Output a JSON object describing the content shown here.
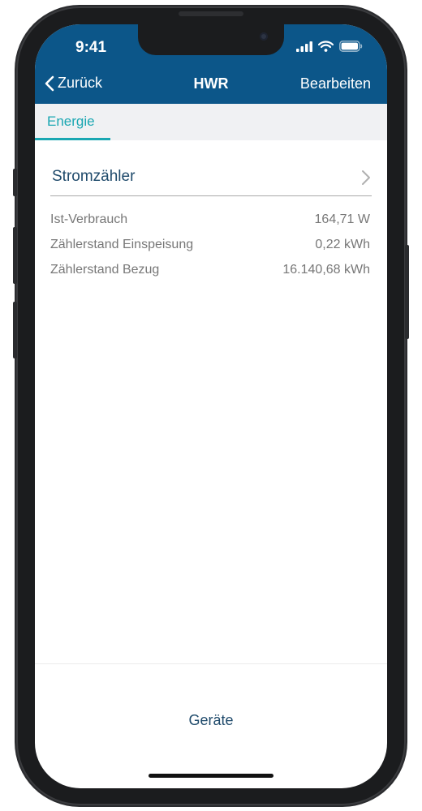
{
  "status_bar": {
    "time": "9:41"
  },
  "nav": {
    "back_label": "Zurück",
    "title": "HWR",
    "edit_label": "Bearbeiten"
  },
  "tabs": [
    {
      "label": "Energie",
      "active": true
    }
  ],
  "device": {
    "name": "Stromzähler",
    "rows": [
      {
        "label": "Ist-Verbrauch",
        "value": "164,71 W"
      },
      {
        "label": "Zählerstand Einspeisung",
        "value": "0,22 kWh"
      },
      {
        "label": "Zählerstand Bezug",
        "value": "16.140,68 kWh"
      }
    ]
  },
  "bottom": {
    "link_label": "Geräte"
  },
  "colors": {
    "nav_background": "#0c5689",
    "accent": "#1aa7b2",
    "primary_text": "#1f4a6b",
    "secondary_text": "#777777"
  },
  "icons": {
    "back": "chevron-left-icon",
    "device_disclosure": "chevron-right-icon",
    "signal": "cellular-signal-icon",
    "wifi": "wifi-icon",
    "battery": "battery-icon"
  }
}
